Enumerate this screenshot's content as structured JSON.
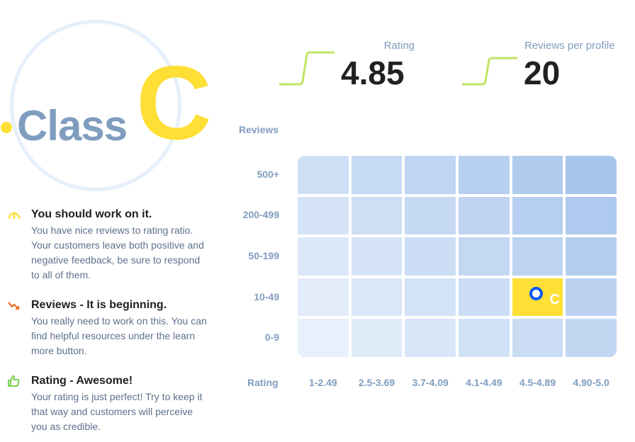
{
  "badge": {
    "prefix_label": "Class",
    "grade": "C"
  },
  "stats": [
    {
      "label": "Rating",
      "value": "4.85"
    },
    {
      "label": "Reviews per profile",
      "value": "20"
    }
  ],
  "feedback": [
    {
      "icon": "gauge-icon",
      "title": "You should work on it.",
      "description": "You have nice reviews to rating ratio. Your customers leave both positive and negative feedback, be sure to respond to all of them."
    },
    {
      "icon": "trend-down-icon",
      "title": "Reviews - It is beginning.",
      "description": "You really need to work on this. You can find helpful resources under the learn more button."
    },
    {
      "icon": "thumbs-up-icon",
      "title": "Rating - Awesome!",
      "description": "Your rating is just perfect! Try to keep it that way and customers will perceive you as credible."
    }
  ],
  "colors": {
    "accent_yellow": "#fddf35",
    "trend_green": "#c1e362",
    "marker_blue": "#0a59f5",
    "label_blue_gray": "#7f9dbf",
    "icon_orange": "#f26b1d",
    "icon_green": "#6bcb3e"
  },
  "chart_data": {
    "type": "heatmap",
    "title": "",
    "ylabel": "Reviews",
    "xlabel": "Rating",
    "y_categories": [
      "500+",
      "200-499",
      "50-199",
      "10-49",
      "0-9"
    ],
    "x_categories": [
      "1-2.49",
      "2.5-3.69",
      "3.7-4.09",
      "4.1-4.49",
      "4.5-4.89",
      "4.90-5.0"
    ],
    "highlight": {
      "row": "10-49",
      "column": "4.5-4.89",
      "label": "C"
    },
    "grid": false
  }
}
